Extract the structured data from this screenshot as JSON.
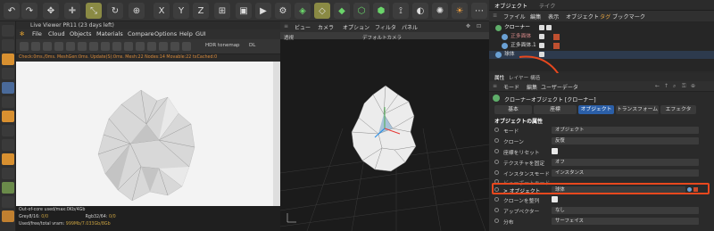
{
  "live_viewer": {
    "title": "Live Viewer PR11 (23 days left)",
    "menu": [
      "File",
      "Cloud",
      "Objects",
      "Materials",
      "Compare",
      "Options",
      "Help",
      "GUI"
    ],
    "tonemap": "HDR tonemap",
    "dl": "DL",
    "status": "Check:0ms./0ms.  MeshGen:0ms. Update(S):0ms. Mesh:22 Nodes:14 Movable:22 txCached:0",
    "bottom": {
      "line1": "Out-of-core used/max:0Kb/4Gb",
      "grey_label": "Grey8/16:",
      "grey_value": "0/0",
      "rgb_label": "Rgb32/64:",
      "rgb_value": "0/0",
      "line3_label": "Used/free/total vram:",
      "line3_value": "999Mb/7.033Gb/8Gb"
    }
  },
  "viewport": {
    "menu": [
      "ビュー",
      "カメラ",
      "オプション",
      "フィルタ",
      "パネル"
    ],
    "label": "透視",
    "camera": "デフォルトカメラ"
  },
  "object_manager": {
    "title_tabs": [
      "オブジェクト",
      "テイク"
    ],
    "menu": [
      "ファイル",
      "編集",
      "表示",
      "オブジェクト",
      "タグ",
      "ブックマーク"
    ],
    "objects": [
      "クローナー",
      "正多面体",
      "正多面体.1",
      "球体"
    ]
  },
  "attributes": {
    "top_tabs": [
      "属性",
      "レイヤー",
      "構造"
    ],
    "menu": [
      "モード",
      "編集",
      "ユーザーデータ"
    ],
    "object_title": "クローナーオブジェクト [クローナー]",
    "tabs": [
      "基本",
      "座標",
      "オブジェクト",
      "トランスフォーム",
      "エフェクタ"
    ],
    "section": "オブジェクトの属性",
    "rows": [
      {
        "label": "モード",
        "value": "オブジェクト"
      },
      {
        "label": "クローン",
        "value": "反復"
      },
      {
        "label": "座標をリセット",
        "value": ""
      },
      {
        "label": "テクスチャを固定",
        "value": "オフ"
      },
      {
        "label": "インスタンスモード",
        "value": "インスタンス"
      },
      {
        "label": "ビューポートモード",
        "value": ""
      },
      {
        "label": "> オブジェクト",
        "value": "球体"
      },
      {
        "label": "クローンを整列",
        "value": ""
      },
      {
        "label": "アップベクター",
        "value": "なし"
      },
      {
        "label": "分布",
        "value": "サーフェイス"
      }
    ]
  },
  "colors": {
    "accent": "#2b5fa8",
    "highlight": "#e8481e",
    "status_text": "#d88a3a"
  }
}
